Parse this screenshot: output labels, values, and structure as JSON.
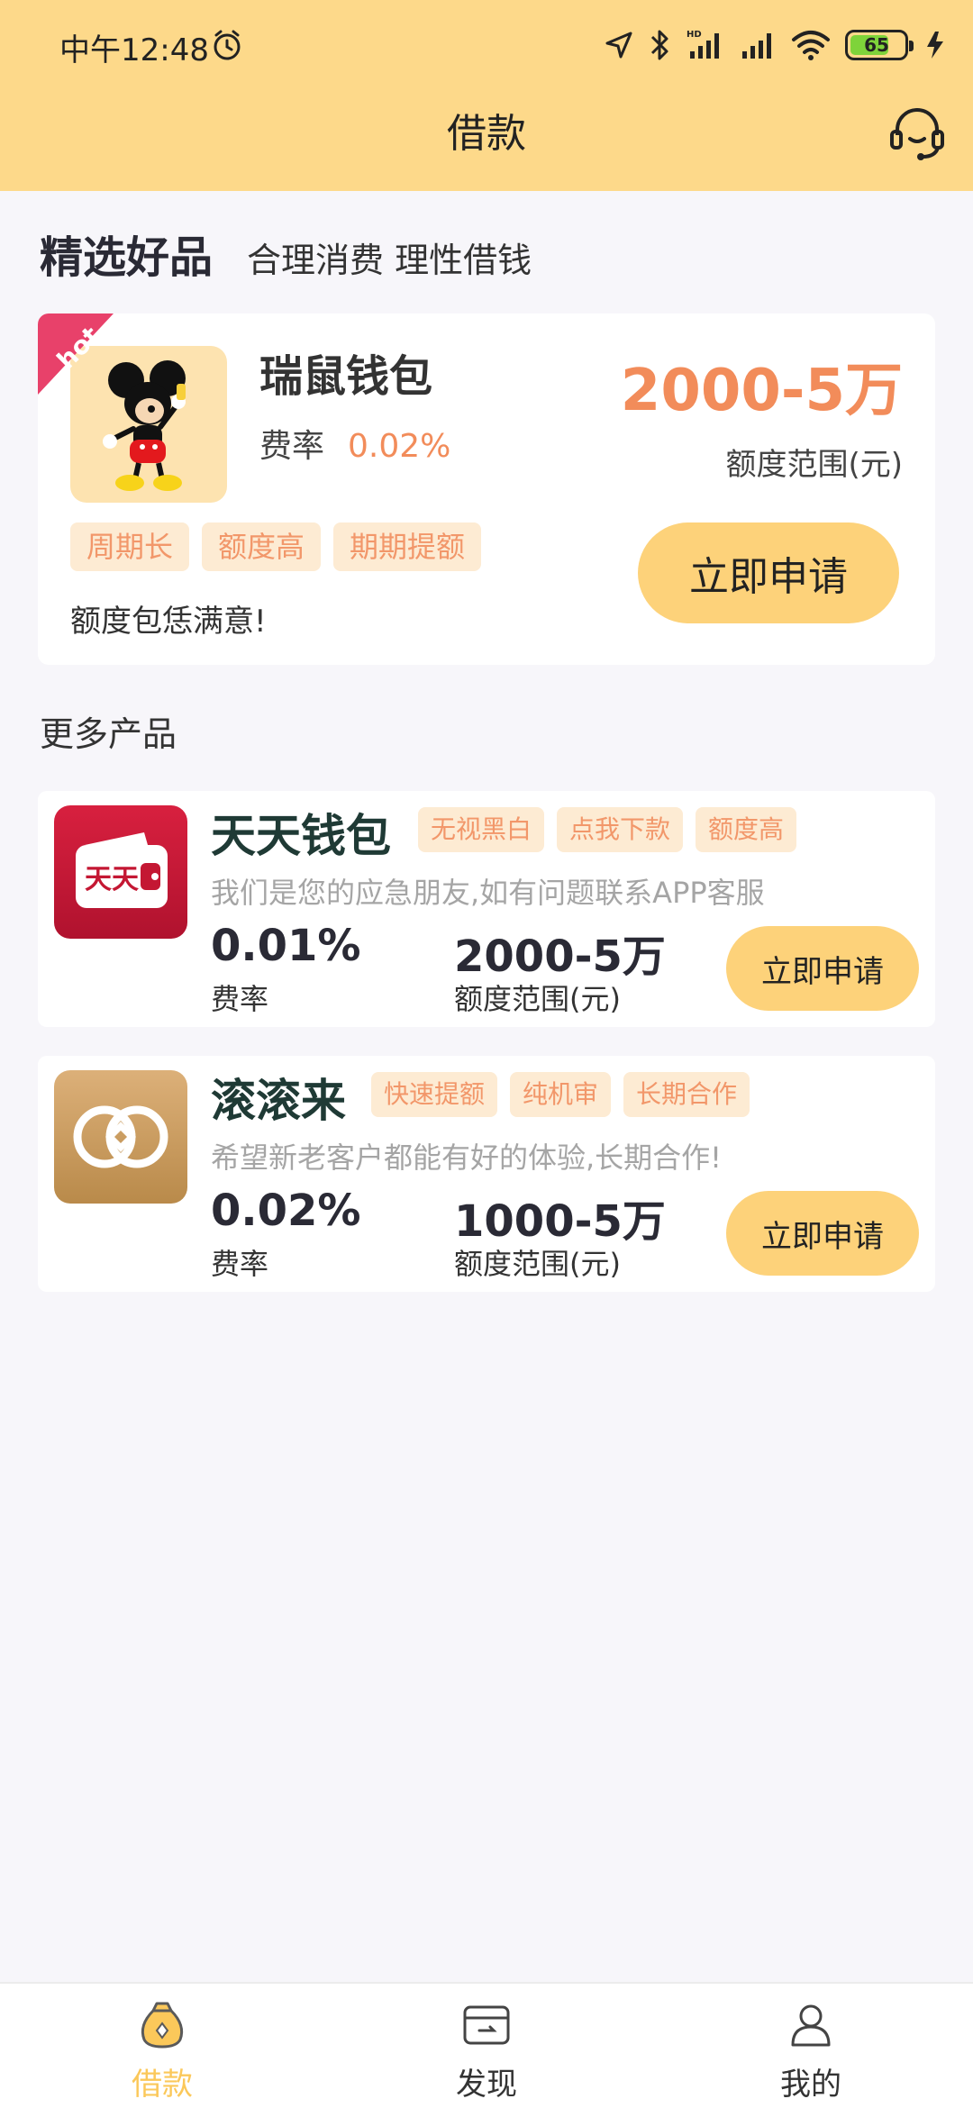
{
  "status_bar": {
    "time": "中午12:48",
    "battery_level": "65"
  },
  "header": {
    "title": "借款"
  },
  "featured_section": {
    "title": "精选好品",
    "subtitle": "合理消费 理性借钱"
  },
  "featured": {
    "badge": "hot",
    "name": "瑞鼠钱包",
    "rate_label": "费率",
    "rate": "0.02%",
    "amount": "2000-5万",
    "amount_label": "额度范围(元)",
    "tags": [
      "周期长",
      "额度高",
      "期期提额"
    ],
    "description": "额度包恁满意!",
    "apply_label": "立即申请"
  },
  "more_title": "更多产品",
  "products": [
    {
      "name": "天天钱包",
      "tags": [
        "无视黑白",
        "点我下款",
        "额度高"
      ],
      "description": "我们是您的应急朋友,如有问题联系APP客服",
      "rate": "0.01%",
      "rate_label": "费率",
      "amount": "2000-5万",
      "amount_label": "额度范围(元)",
      "apply_label": "立即申请",
      "logo_text": "天天"
    },
    {
      "name": "滚滚来",
      "tags": [
        "快速提额",
        "纯机审",
        "长期合作"
      ],
      "description": "希望新老客户都能有好的体验,长期合作!",
      "rate": "0.02%",
      "rate_label": "费率",
      "amount": "1000-5万",
      "amount_label": "额度范围(元)",
      "apply_label": "立即申请"
    }
  ],
  "bottom_nav": [
    {
      "label": "借款",
      "icon": "money-bag-icon",
      "active": true
    },
    {
      "label": "发现",
      "icon": "card-icon",
      "active": false
    },
    {
      "label": "我的",
      "icon": "user-icon",
      "active": false
    }
  ],
  "colors": {
    "accent": "#fdd98a",
    "button": "#fdd27a",
    "highlight": "#f28c5a",
    "nav_active": "#fbc85a"
  }
}
